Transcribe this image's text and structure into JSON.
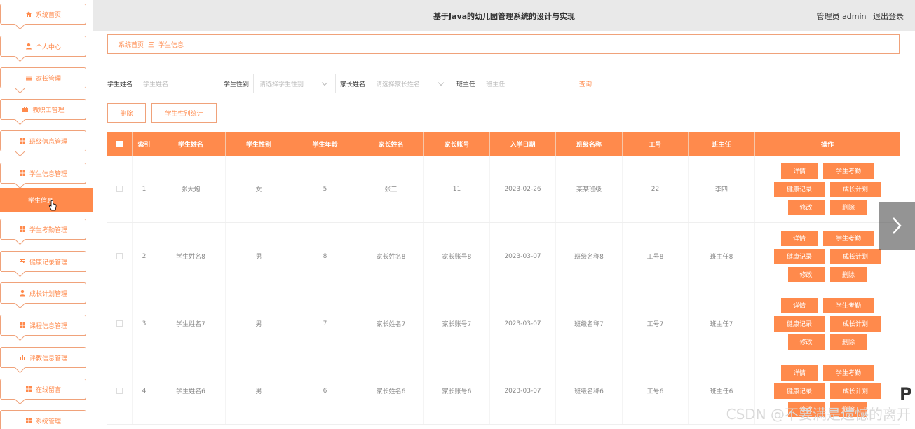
{
  "header": {
    "title": "基于Java的幼儿园管理系统的设计与实现",
    "user_label": "管理员 admin",
    "logout": "退出登录"
  },
  "sidebar": {
    "items": [
      {
        "label": "系统首页",
        "icon": "home-icon"
      },
      {
        "label": "个人中心",
        "icon": "user-icon"
      },
      {
        "label": "家长管理",
        "icon": "list-icon"
      },
      {
        "label": "教职工管理",
        "icon": "briefcase-icon"
      },
      {
        "label": "班级信息管理",
        "icon": "grid-icon"
      },
      {
        "label": "学生信息管理",
        "icon": "grid-icon"
      },
      {
        "label": "学生考勤管理",
        "icon": "grid-icon"
      },
      {
        "label": "健康记录管理",
        "icon": "sliders-icon"
      },
      {
        "label": "成长计划管理",
        "icon": "user-icon"
      },
      {
        "label": "课程信息管理",
        "icon": "grid-icon"
      },
      {
        "label": "评教信息管理",
        "icon": "bar-chart-icon"
      },
      {
        "label": "在线留言",
        "icon": "grid-icon"
      },
      {
        "label": "系统管理",
        "icon": "grid-icon"
      }
    ],
    "active_sub": "学生信息"
  },
  "breadcrumb": {
    "home": "系统首页",
    "sep": "三",
    "current": "学生信息"
  },
  "search": {
    "name_label": "学生姓名",
    "name_placeholder": "学生姓名",
    "gender_label": "学生性别",
    "gender_placeholder": "请选择学生性别",
    "parent_label": "家长姓名",
    "parent_placeholder": "请选择家长姓名",
    "teacher_label": "班主任",
    "teacher_placeholder": "班主任",
    "query_button": "查询"
  },
  "actions": {
    "delete": "删除",
    "stats": "学生性别统计"
  },
  "table": {
    "headers": [
      "索引",
      "学生姓名",
      "学生性别",
      "学生年龄",
      "家长姓名",
      "家长账号",
      "入学日期",
      "班级名称",
      "工号",
      "班主任",
      "操作"
    ],
    "rows": [
      {
        "idx": "1",
        "name": "张大炮",
        "gender": "女",
        "age": "5",
        "parent": "张三",
        "account": "11",
        "date": "2023-02-26",
        "class": "某某班级",
        "no": "22",
        "teacher": "李四"
      },
      {
        "idx": "2",
        "name": "学生姓名8",
        "gender": "男",
        "age": "8",
        "parent": "家长姓名8",
        "account": "家长账号8",
        "date": "2023-03-07",
        "class": "班级名称8",
        "no": "工号8",
        "teacher": "班主任8"
      },
      {
        "idx": "3",
        "name": "学生姓名7",
        "gender": "男",
        "age": "7",
        "parent": "家长姓名7",
        "account": "家长账号7",
        "date": "2023-03-07",
        "class": "班级名称7",
        "no": "工号7",
        "teacher": "班主任7"
      },
      {
        "idx": "4",
        "name": "学生姓名6",
        "gender": "男",
        "age": "6",
        "parent": "家长姓名6",
        "account": "家长账号6",
        "date": "2023-03-07",
        "class": "班级名称6",
        "no": "工号6",
        "teacher": "班主任6"
      }
    ],
    "ops": {
      "detail": "详情",
      "attendance": "学生考勤",
      "health": "健康记录",
      "growth": "成长计划",
      "edit": "修改",
      "delete": "删除"
    }
  },
  "watermark": "CSDN @不要满是遗憾的离开",
  "edge_glyph": "P",
  "colors": {
    "accent": "#ff8a4c",
    "header_bg": "#e9e9e9"
  }
}
